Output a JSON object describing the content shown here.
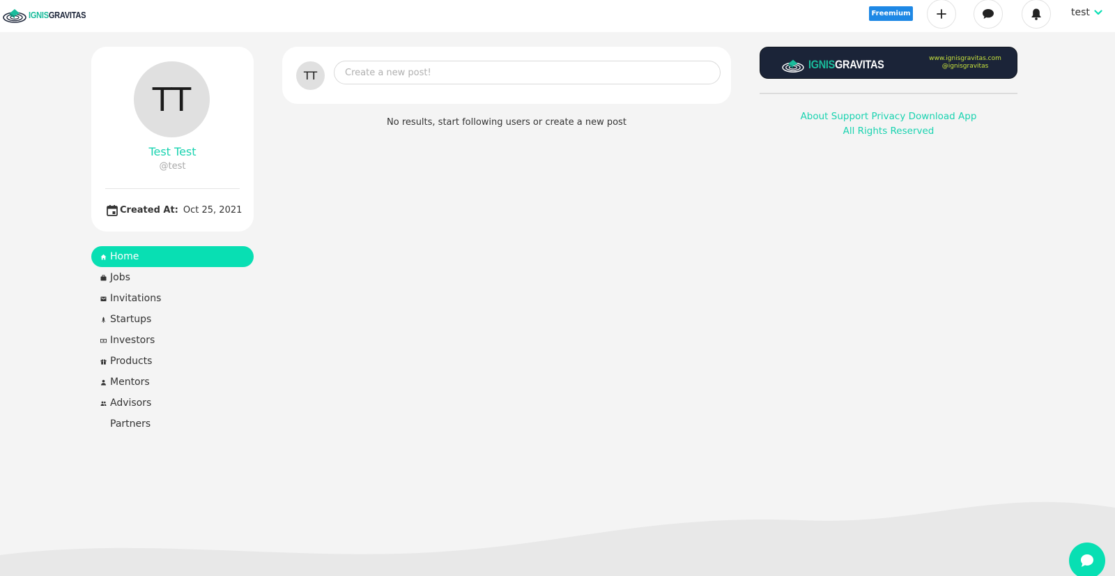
{
  "header": {
    "logo": {
      "part1": "IGNIS",
      "part2": "GRAVITAS"
    },
    "plan_badge": "Freemium",
    "icons": {
      "add": "plus-icon",
      "chat": "chat-bubble-icon",
      "notifications": "bell-icon",
      "user_menu": "chevron-down-icon"
    },
    "username": "test"
  },
  "profile": {
    "initials": "TT",
    "name": "Test Test",
    "handle": "@test",
    "created_label": "Created At:",
    "created_value": "Oct 25, 2021",
    "created_icon": "calendar-icon"
  },
  "nav": {
    "items": [
      {
        "label": "Home",
        "icon": "home-icon",
        "active": true
      },
      {
        "label": "Jobs",
        "icon": "briefcase-icon"
      },
      {
        "label": "Invitations",
        "icon": "mail-icon"
      },
      {
        "label": "Startups",
        "icon": "rocket-icon"
      },
      {
        "label": "Investors",
        "icon": "money-icon"
      },
      {
        "label": "Products",
        "icon": "gift-icon"
      },
      {
        "label": "Mentors",
        "icon": "person-icon"
      },
      {
        "label": "Advisors",
        "icon": "people-icon"
      },
      {
        "label": "Partners",
        "icon": ""
      }
    ]
  },
  "composer": {
    "initials": "TT",
    "placeholder": "Create a new post!"
  },
  "feed": {
    "empty_message": "No results, start following users or create a new post"
  },
  "sidebar_right": {
    "banner": {
      "part1": "IGNIS",
      "part2": "GRAVITAS",
      "url": "www.ignisgravitas.com",
      "social": "@ignisgravitas"
    },
    "links": [
      "About",
      "Support",
      "Privacy",
      "Download App"
    ],
    "copyright": "All Rights Reserved"
  },
  "colors": {
    "accent": "#08dfb3",
    "accent_text": "#19d3b0",
    "badge": "#1e88e5",
    "banner_bg": "#1b2438",
    "background": "#f4f4f4"
  },
  "chat_fab": {
    "icon": "chat-bubble-icon"
  }
}
